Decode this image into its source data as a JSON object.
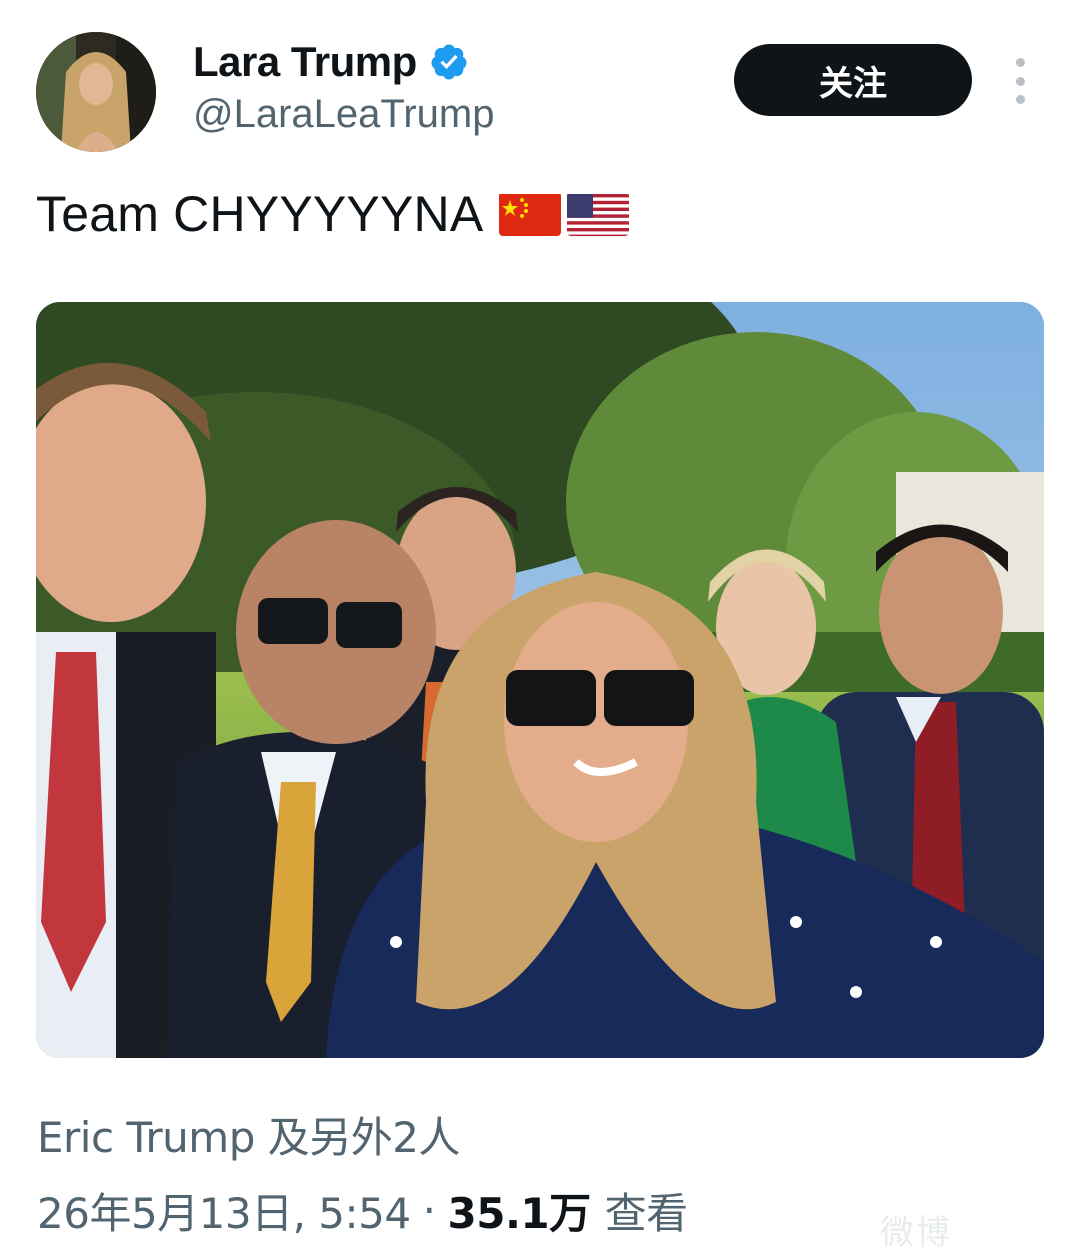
{
  "tweet": {
    "display_name": "Lara Trump",
    "handle": "@LaraLeaTrump",
    "verified_icon": "verified-badge-icon",
    "follow_label": "关注",
    "more_icon": "more-vertical-icon",
    "text": "Team CHYYYYYNA",
    "emoji": [
      "china-flag-icon",
      "us-flag-icon"
    ],
    "media_alt": "photo",
    "tagged": "Eric Trump 及另外2人",
    "date": "26年5月13日, 5:54",
    "separator": "·",
    "views_count": "35.1万",
    "views_label": "查看",
    "watermark": "微博"
  },
  "colors": {
    "text_primary": "#0f1419",
    "text_secondary": "#536471",
    "verified": "#1d9bf0",
    "button_bg": "#0f1419"
  }
}
